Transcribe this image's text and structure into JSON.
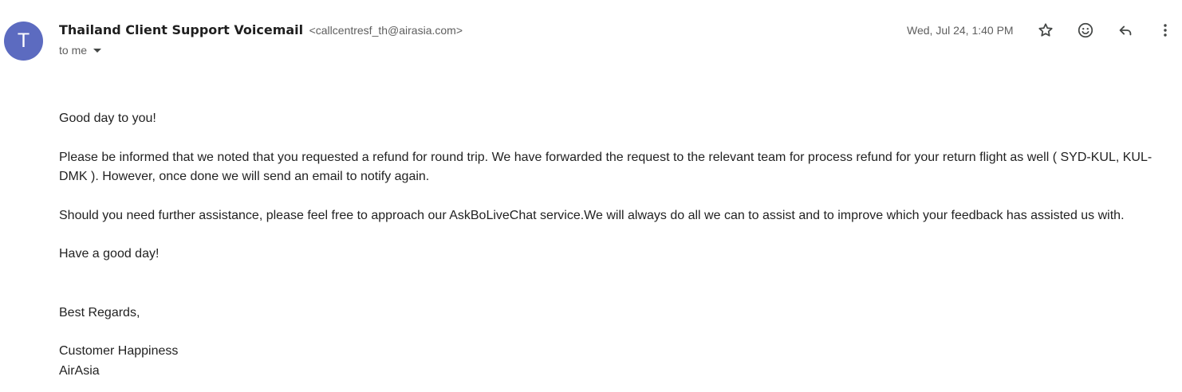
{
  "sender": {
    "avatar_initial": "T",
    "name": "Thailand Client Support Voicemail",
    "email": "<callcentresf_th@airasia.com>",
    "recipient_label": "to me",
    "avatar_color": "#5c6bc0"
  },
  "header": {
    "date": "Wed, Jul 24, 1:40 PM",
    "icons": [
      "star-icon",
      "emoji-icon",
      "reply-icon",
      "more-vert-icon"
    ]
  },
  "message": {
    "greeting": "Good day to you!",
    "paragraph_info": "Please be informed that we noted that you requested a refund for round trip. We have forwarded the request to the relevant team for process refund for your return flight as well ( SYD-KUL, KUL-DMK ). However, once done we will send an email to notify again.",
    "paragraph_assist": "Should you need further assistance, please feel free to approach our AskBoLiveChat service.We will always do all we can to assist and to improve which your feedback has assisted us with.",
    "closing_wish": "Have a good day!",
    "regards": "Best Regards,",
    "team": "Customer Happiness",
    "company": "AirAsia"
  }
}
